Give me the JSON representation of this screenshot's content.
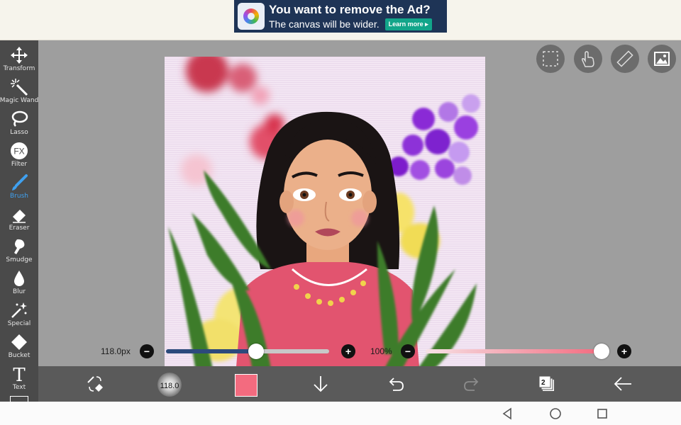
{
  "ad": {
    "title": "You want to remove the Ad?",
    "subtitle": "The canvas will be wider.",
    "button": "Learn more ▸"
  },
  "tools": [
    {
      "name": "Transform",
      "icon": "move-icon",
      "active": false
    },
    {
      "name": "Magic Wand",
      "icon": "magic-wand-icon",
      "active": false
    },
    {
      "name": "Lasso",
      "icon": "lasso-icon",
      "active": false
    },
    {
      "name": "Filter",
      "icon": "fx-icon",
      "active": false
    },
    {
      "name": "Brush",
      "icon": "brush-icon",
      "active": true
    },
    {
      "name": "Eraser",
      "icon": "eraser-icon",
      "active": false
    },
    {
      "name": "Smudge",
      "icon": "smudge-icon",
      "active": false
    },
    {
      "name": "Blur",
      "icon": "drop-icon",
      "active": false
    },
    {
      "name": "Special",
      "icon": "sparkle-icon",
      "active": false
    },
    {
      "name": "Bucket",
      "icon": "bucket-icon",
      "active": false
    },
    {
      "name": "Text",
      "icon": "text-icon",
      "active": false
    }
  ],
  "top_buttons": [
    {
      "icon": "selection-icon"
    },
    {
      "icon": "hand-icon"
    },
    {
      "icon": "ruler-icon"
    },
    {
      "icon": "image-icon"
    }
  ],
  "brush": {
    "size_label": "118.0px",
    "size_fraction": 0.55,
    "opacity_label": "100%",
    "opacity_fraction": 1.0,
    "size_preview": "118.0"
  },
  "colors": {
    "primary": "#f36b7f",
    "accent": "#3fa0ef",
    "slider_fill": "#2c4a7c"
  },
  "bottom": {
    "layers_count": "2"
  }
}
